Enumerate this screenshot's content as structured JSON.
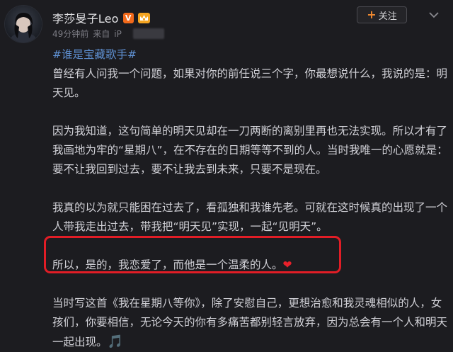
{
  "post": {
    "author": "李莎旻子Leo",
    "verified_badge": "V",
    "time": "49分钟前",
    "source_prefix": "来自",
    "source_partial": "iP",
    "follow_label": "关注",
    "follow_plus": "+",
    "hashtag": "#谁是宝藏歌手#",
    "paragraphs": [
      "曾经有人问我一个问题，如果对你的前任说三个字，你最想说什么，我说的是：明天见。",
      "因为我知道，这句简单的明天见却在一刀两断的离别里再也无法实现。所以才有了我画地为牢的“星期八”，在不存在的日期等等不到的人。当时我唯一的心愿就是：要不让我回到过去，要不让我去到未来，只要不是现在。",
      "我真的以为就只能困在过去了，看孤独和我谁先老。可就在这时候真的出现了一个人带我走出过去，带我把“明天见”实现，一起“见明天”。",
      "所以，是的，我恋爱了，而他是一个温柔的人。",
      "当时写这首《我在星期八等你》，除了安慰自己，更想治愈和我灵魂相似的人，女孩们，你要相信，无论今天的你有多痛苦都别轻言放弃，因为总会有一个人和明天一起出现。"
    ],
    "heart_glyph": "❤",
    "note_glyph": "🎵"
  },
  "icons": {
    "avatar": "avatar-photo",
    "verified": "verified-v-icon",
    "crown": "crown-badge-icon",
    "more": "chevron-down-icon",
    "heart": "heart-emoji-icon",
    "music": "music-note-icon"
  },
  "colors": {
    "background": "#1c1c20",
    "hashtag": "#5e8fd0",
    "highlight_border": "#e11d26",
    "follow_plus": "#f08a30"
  }
}
